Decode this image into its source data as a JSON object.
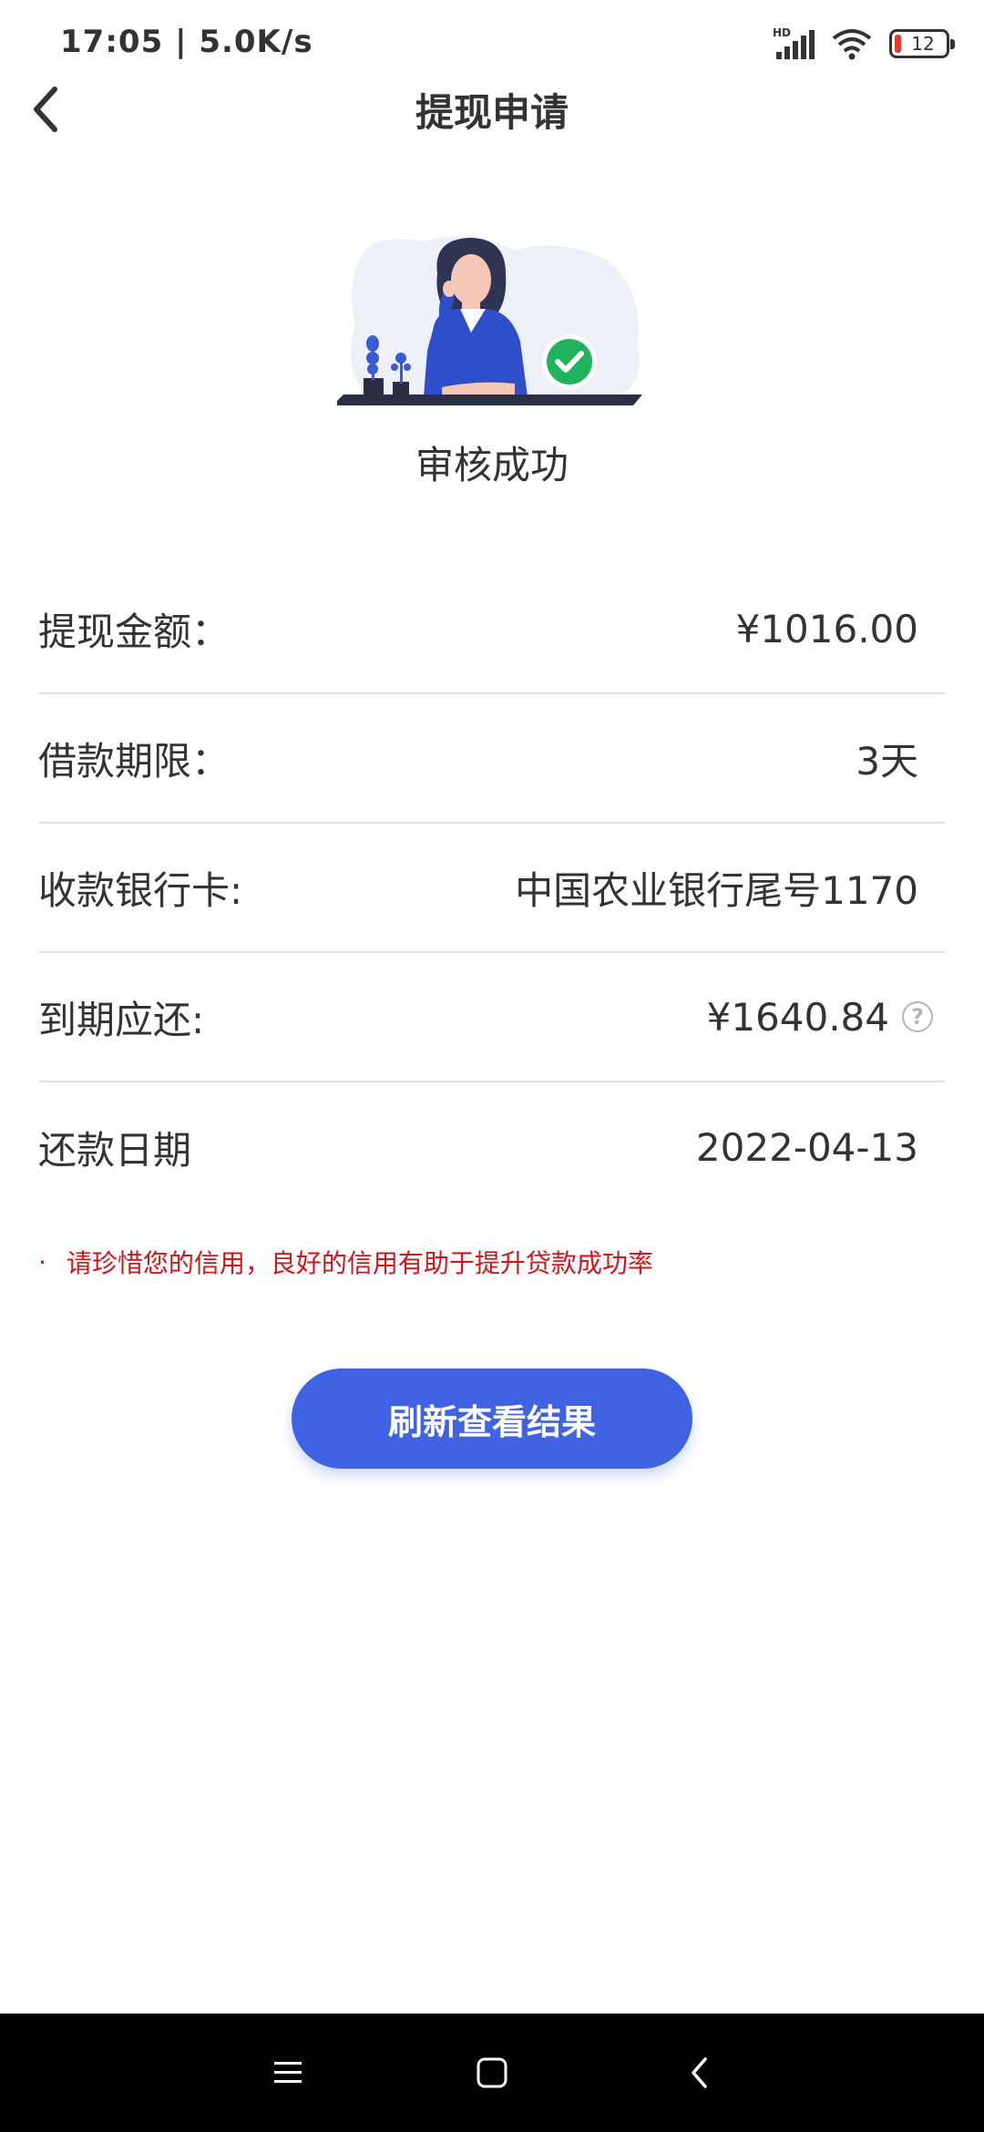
{
  "status_bar": {
    "time": "17:05 | 5.0K/s",
    "battery_level": "12",
    "network_badge": "HD",
    "icons": [
      "signal-icon",
      "wifi-icon",
      "battery-icon"
    ]
  },
  "nav": {
    "title": "提现申请",
    "back_icon": "chevron-left-icon"
  },
  "result": {
    "status_text": "审核成功",
    "illustration": "woman-at-desk-with-check-illustration",
    "success_color": "#1fb35c"
  },
  "details": [
    {
      "label": "提现金额：",
      "value": "¥1016.00"
    },
    {
      "label": "借款期限：",
      "value": "3天"
    },
    {
      "label": "收款银行卡:",
      "value": "中国农业银行尾号1170"
    },
    {
      "label": "到期应还:",
      "value": "¥1640.84",
      "help_icon": "question-circle-icon",
      "help_glyph": "?"
    },
    {
      "label": "还款日期",
      "value": "2022-04-13"
    }
  ],
  "notice": {
    "bullet": "·",
    "text": "请珍惜您的信用，良好的信用有助于提升贷款成功率",
    "color": "#d2141b"
  },
  "actions": {
    "refresh_label": "刷新查看结果",
    "accent": "#3f63e3"
  },
  "system_nav": [
    "menu-icon",
    "home-icon",
    "back-icon"
  ]
}
